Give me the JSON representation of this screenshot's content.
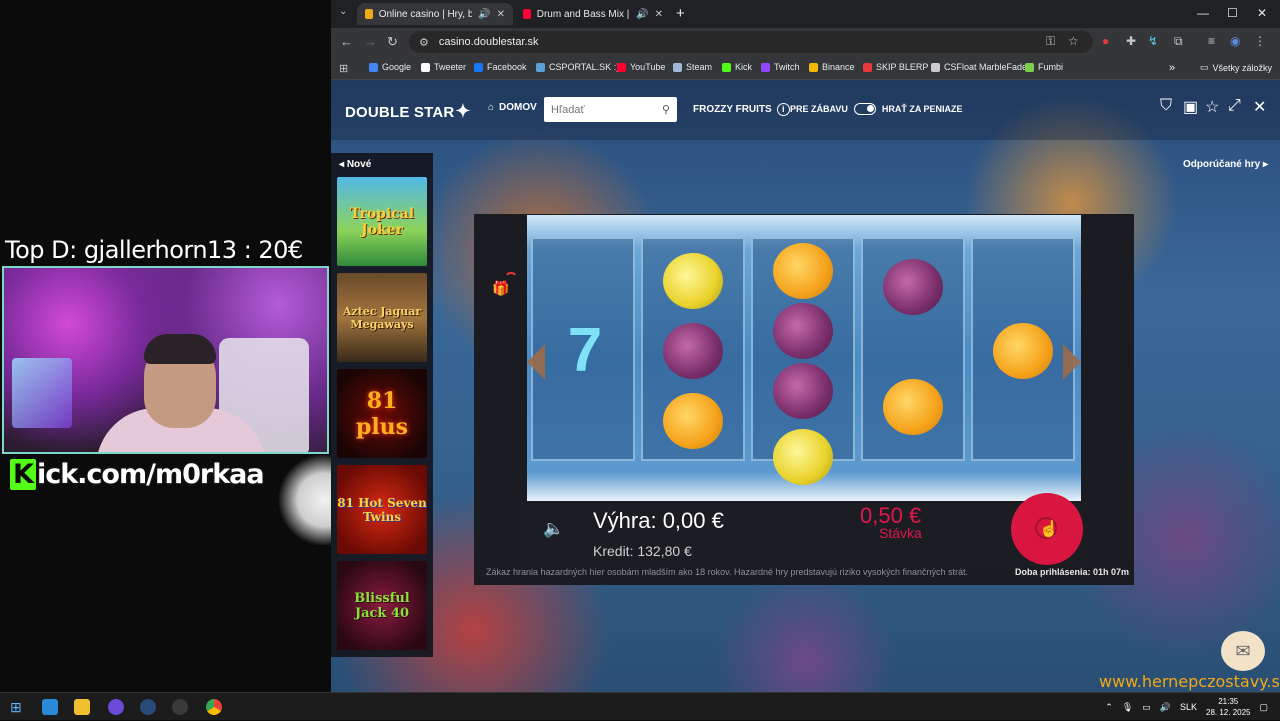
{
  "overlay": {
    "top_donor": "Top D: gjallerhorn13 : 20€",
    "kick_letter": "K",
    "kick_rest": "ick.com/m0rkaa"
  },
  "browser": {
    "tabs": [
      {
        "title": "Online casino | Hry, bonusy",
        "fav_color": "#f0a818"
      },
      {
        "title": "Drum and Bass Mix | Week",
        "fav_color": "#ff0033"
      }
    ],
    "url": "casino.doublestar.sk",
    "bookmarks": [
      {
        "label": "Google",
        "color": "#4285f4"
      },
      {
        "label": "Tweeter",
        "color": "#ffffff"
      },
      {
        "label": "Facebook",
        "color": "#1877f2"
      },
      {
        "label": "CSPORTAL.SK :)",
        "color": "#5aa0d8"
      },
      {
        "label": "YouTube",
        "color": "#ff0033"
      },
      {
        "label": "Steam",
        "color": "#9fb7d8"
      },
      {
        "label": "Kick",
        "color": "#53fc18"
      },
      {
        "label": "Twitch",
        "color": "#9146ff"
      },
      {
        "label": "Binance",
        "color": "#f0b90b"
      },
      {
        "label": "SKIP BLERP",
        "color": "#e83a3a"
      },
      {
        "label": "CSFloat MarbleFade",
        "color": "#cccccc"
      },
      {
        "label": "Fumbi",
        "color": "#7ad04a"
      }
    ],
    "all_bookmarks": "Všetky záložky"
  },
  "casino": {
    "logo": "DOUBLE STAR",
    "home": "DOMOV",
    "search_placeholder": "Hľadať",
    "game_title": "FROZZY FRUITS",
    "mode_fun": "PRE ZÁBAVU",
    "mode_money": "HRAŤ ZA PENIAZE",
    "new_label": "Nové",
    "recommended": "Odporúčané hry",
    "thumbnails": [
      {
        "title": "Tropical Joker"
      },
      {
        "title": "Aztec Jaguar Megaways"
      },
      {
        "title": "81 plus"
      },
      {
        "title": "81 Hot Seven Twins"
      },
      {
        "title": "Blissful Jack 40"
      }
    ],
    "win": "Výhra: 0,00 €",
    "credit": "Kredit: 132,80 €",
    "bet_value": "0,50 €",
    "bet_label": "Stávka",
    "disclaimer": "Zákaz hrania hazardných hier osobám mladším ako 18 rokov. Hazardné hry predstavujú riziko vysokých finančných strát.",
    "session": "Doba prihlásenia: 01h 07m"
  },
  "watermark": "www.hernepczostavy.sk",
  "taskbar": {
    "language": "SLK",
    "time": "21:35",
    "date": "28. 12. 2025"
  }
}
